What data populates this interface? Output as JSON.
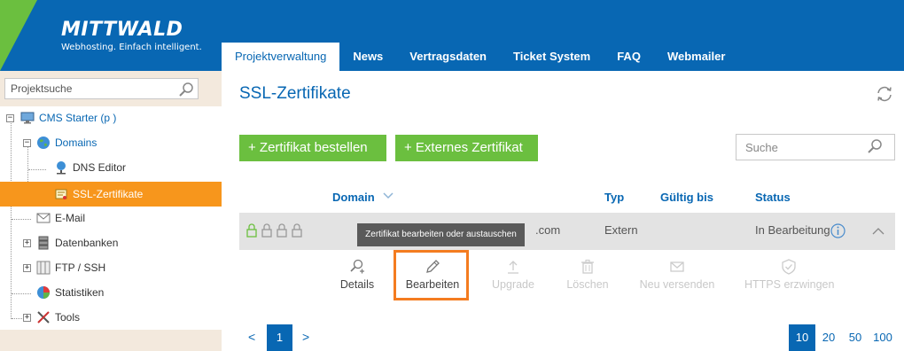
{
  "brand": {
    "name": "MITTWALD",
    "tagline": "Webhosting. Einfach intelligent."
  },
  "nav": {
    "tabs": [
      {
        "label": "Projektverwaltung",
        "active": true
      },
      {
        "label": "News"
      },
      {
        "label": "Vertragsdaten"
      },
      {
        "label": "Ticket System"
      },
      {
        "label": "FAQ"
      },
      {
        "label": "Webmailer"
      }
    ]
  },
  "sidebar": {
    "search_placeholder": "Projektsuche",
    "tree": [
      {
        "label": "CMS Starter (p            )",
        "icon": "monitor-icon",
        "toggle": "minus"
      },
      {
        "label": "Domains",
        "icon": "globe-icon",
        "toggle": "minus"
      },
      {
        "label": "DNS Editor",
        "icon": "dns-globe-icon"
      },
      {
        "label": "SSL-Zertifikate",
        "icon": "certificate-icon",
        "selected": true
      },
      {
        "label": "E-Mail",
        "icon": "envelope-icon"
      },
      {
        "label": "Datenbanken",
        "icon": "database-icon",
        "toggle": "plus"
      },
      {
        "label": "FTP / SSH",
        "icon": "ftp-icon",
        "toggle": "plus"
      },
      {
        "label": "Statistiken",
        "icon": "pie-chart-icon"
      },
      {
        "label": "Tools",
        "icon": "tools-icon",
        "toggle": "plus"
      }
    ]
  },
  "main": {
    "title": "SSL-Zertifikate",
    "buttons": {
      "order": "+ Zertifikat bestellen",
      "external": "+ Externes Zertifikat"
    },
    "search_placeholder": "Suche",
    "table": {
      "headers": {
        "domain": "Domain",
        "type": "Typ",
        "valid_until": "Gültig bis",
        "status": "Status"
      },
      "rows": [
        {
          "domain": ".com",
          "type": "Extern",
          "valid_until": "",
          "status": "In Bearbeitung"
        }
      ]
    },
    "tooltip": "Zertifikat bearbeiten oder austauschen",
    "actions": [
      {
        "label": "Details",
        "icon": "details-icon",
        "enabled": true
      },
      {
        "label": "Bearbeiten",
        "icon": "pencil-icon",
        "enabled": true
      },
      {
        "label": "Upgrade",
        "icon": "upload-icon",
        "enabled": false
      },
      {
        "label": "Löschen",
        "icon": "trash-icon",
        "enabled": false
      },
      {
        "label": "Neu versenden",
        "icon": "mail-icon",
        "enabled": false
      },
      {
        "label": "HTTPS erzwingen",
        "icon": "shield-check-icon",
        "enabled": false
      }
    ],
    "pagination": {
      "prev": "<",
      "current_page": "1",
      "next": ">",
      "page_sizes": [
        "10",
        "20",
        "50",
        "100"
      ],
      "active_page_size": "10"
    }
  },
  "colors": {
    "primary_blue": "#0867b3",
    "accent_green": "#6bbf3f",
    "selected_orange": "#f7961c",
    "highlight_orange": "#f47c20",
    "sidebar_beige": "#f3e9dd"
  }
}
